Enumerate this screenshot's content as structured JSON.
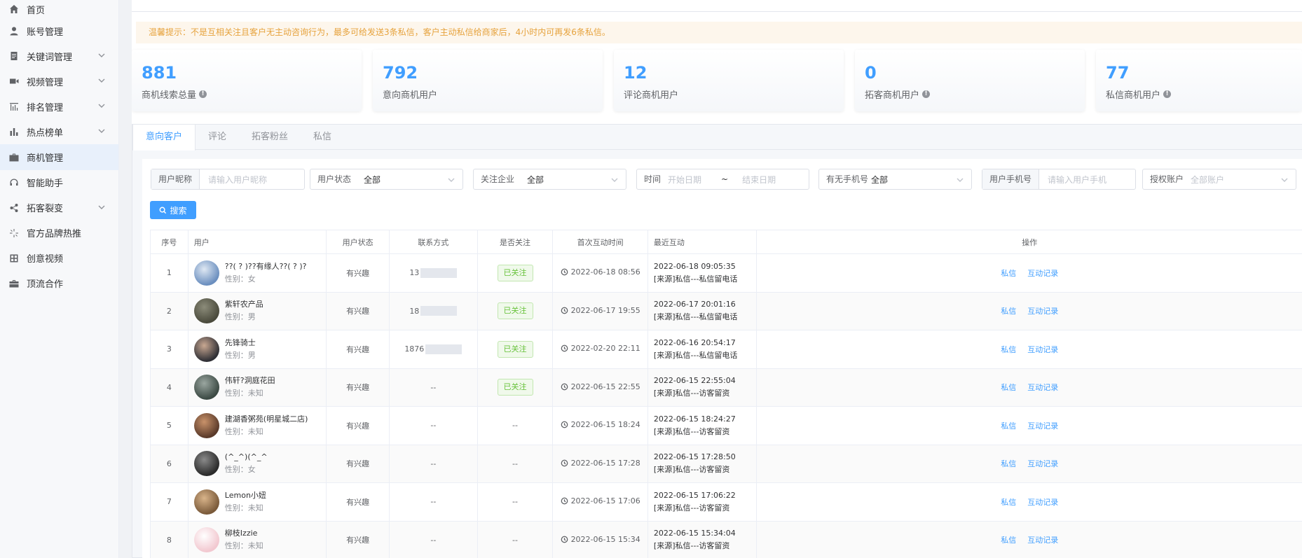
{
  "sidebar": {
    "items": [
      {
        "label": "首页",
        "icon": "home-icon",
        "chevron": false,
        "active": false
      },
      {
        "label": "账号管理",
        "icon": "user-icon",
        "chevron": false,
        "active": false
      },
      {
        "label": "关键词管理",
        "icon": "document-icon",
        "chevron": true,
        "active": false
      },
      {
        "label": "视频管理",
        "icon": "video-icon",
        "chevron": true,
        "active": false
      },
      {
        "label": "排名管理",
        "icon": "ranking-icon",
        "chevron": true,
        "active": false
      },
      {
        "label": "热点榜单",
        "icon": "bar-chart-icon",
        "chevron": true,
        "active": false
      },
      {
        "label": "商机管理",
        "icon": "briefcase-icon",
        "chevron": false,
        "active": true
      },
      {
        "label": "智能助手",
        "icon": "headset-icon",
        "chevron": false,
        "active": false
      },
      {
        "label": "拓客裂变",
        "icon": "share-icon",
        "chevron": true,
        "active": false
      },
      {
        "label": "官方品牌热推",
        "icon": "sparkle-icon",
        "chevron": false,
        "active": false
      },
      {
        "label": "创意视频",
        "icon": "grid-icon",
        "chevron": false,
        "active": false
      },
      {
        "label": "顶流合作",
        "icon": "toolbox-icon",
        "chevron": false,
        "active": false
      }
    ]
  },
  "notice": "温馨提示：不是互相关注且客户无主动咨询行为，最多可给发送3条私信，客户主动私信给商家后，4小时内可再发6条私信。",
  "stats": [
    {
      "value": "881",
      "label": "商机线索总量",
      "info": true
    },
    {
      "value": "792",
      "label": "意向商机用户",
      "info": false
    },
    {
      "value": "12",
      "label": "评论商机用户",
      "info": false
    },
    {
      "value": "0",
      "label": "拓客商机用户",
      "info": true
    },
    {
      "value": "77",
      "label": "私信商机用户",
      "info": true
    }
  ],
  "tabs": [
    "意向客户",
    "评论",
    "拓客粉丝",
    "私信"
  ],
  "filters": {
    "nickname_label": "用户昵称",
    "nickname_placeholder": "请输入用户昵称",
    "status_label": "用户状态",
    "status_value": "全部",
    "follow_label": "关注企业",
    "follow_value": "全部",
    "time_label": "时间",
    "start_placeholder": "开始日期",
    "range_sep": "~",
    "end_placeholder": "结束日期",
    "phone_has_label": "有无手机号",
    "phone_has_value": "全部",
    "mobile_label": "用户手机号",
    "mobile_placeholder": "请输入用户手机",
    "account_label": "授权账户",
    "account_placeholder": "全部账户"
  },
  "search_label": "搜索",
  "table": {
    "headers": [
      "序号",
      "用户",
      "用户状态",
      "联系方式",
      "是否关注",
      "首次互动时间",
      "最近互动",
      "操作"
    ],
    "rows": [
      {
        "no": "1",
        "name": "??( ? )??有缘人??( ? )?",
        "gender": "性别：女",
        "status": "有兴趣",
        "phone": "13",
        "masked": true,
        "followed": "已关注",
        "first": "2022-06-18 08:56",
        "recent_time": "2022-06-18 09:05:35",
        "recent_src": "[来源]私信---私信留电话",
        "avatar": [
          "#6b8fbf",
          "#dfe8f3"
        ]
      },
      {
        "no": "2",
        "name": "紫轩农产品",
        "gender": "性别：男",
        "status": "有兴趣",
        "phone": "18",
        "masked": true,
        "followed": "已关注",
        "first": "2022-06-17 19:55",
        "recent_time": "2022-06-17 20:01:16",
        "recent_src": "[来源]私信---私信留电话",
        "avatar": [
          "#4a4a3c",
          "#8c8c7a"
        ]
      },
      {
        "no": "3",
        "name": "先锋骑士",
        "gender": "性别：男",
        "status": "有兴趣",
        "phone": "1876",
        "masked": true,
        "followed": "已关注",
        "first": "2022-02-20 22:11",
        "recent_time": "2022-06-16 20:54:17",
        "recent_src": "[来源]私信---私信留电话",
        "avatar": [
          "#2f2f35",
          "#c9a892"
        ]
      },
      {
        "no": "4",
        "name": "伟轩?洞庭花田",
        "gender": "性别：未知",
        "status": "有兴趣",
        "phone": "--",
        "masked": false,
        "followed": "已关注",
        "first": "2022-06-15 22:55",
        "recent_time": "2022-06-15 22:55:04",
        "recent_src": "[来源]私信---访客留资",
        "avatar": [
          "#3c4a44",
          "#9aa6a0"
        ]
      },
      {
        "no": "5",
        "name": "建湖香粥苑(明星城二店)",
        "gender": "性别：未知",
        "status": "有兴趣",
        "phone": "--",
        "masked": false,
        "followed": "--",
        "first": "2022-06-15 18:24",
        "recent_time": "2022-06-15 18:24:27",
        "recent_src": "[来源]私信---访客留资",
        "avatar": [
          "#5a3a2a",
          "#c9926a"
        ]
      },
      {
        "no": "6",
        "name": "(^_^)(^_^",
        "gender": "性别：女",
        "status": "有兴趣",
        "phone": "--",
        "masked": false,
        "followed": "--",
        "first": "2022-06-15 17:28",
        "recent_time": "2022-06-15 17:28:50",
        "recent_src": "[来源]私信---访客留资",
        "avatar": [
          "#2a2a2a",
          "#8a8a8a"
        ]
      },
      {
        "no": "7",
        "name": "Lemon小妞",
        "gender": "性别：未知",
        "status": "有兴趣",
        "phone": "--",
        "masked": false,
        "followed": "--",
        "first": "2022-06-15 17:06",
        "recent_time": "2022-06-15 17:06:22",
        "recent_src": "[来源]私信---访客留资",
        "avatar": [
          "#7a5a3a",
          "#d9b48a"
        ]
      },
      {
        "no": "8",
        "name": "柳枝Izzie",
        "gender": "性别：未知",
        "status": "有兴趣",
        "phone": "--",
        "masked": false,
        "followed": "--",
        "first": "2022-06-15 15:34",
        "recent_time": "2022-06-15 15:34:04",
        "recent_src": "[来源]私信---访客留资",
        "avatar": [
          "#f2c8d0",
          "#ffffff"
        ]
      }
    ],
    "op_message": "私信",
    "op_history": "互动记录"
  },
  "colors": {
    "accent": "#409eff",
    "success": "#67c23a",
    "warning": "#e6a23c"
  }
}
